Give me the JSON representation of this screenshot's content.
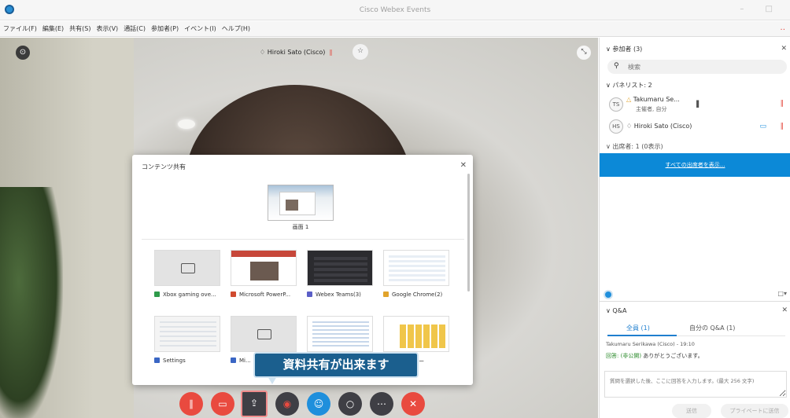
{
  "window": {
    "title": "Cisco Webex Events",
    "controls": "– □"
  },
  "menu": {
    "items": [
      "ファイル(F)",
      "編集(E)",
      "共有(S)",
      "表示(V)",
      "通話(C)",
      "参加者(P)",
      "イベント(I)",
      "ヘルプ(H)"
    ]
  },
  "video": {
    "speaker": "Hiroki Sato (Cisco)"
  },
  "share_dialog": {
    "title": "コンテンツ共有",
    "screen_label": "画面 1",
    "apps": [
      {
        "label": "Xbox gaming ove...",
        "thumb": "blank",
        "color": "#2e9b4a"
      },
      {
        "label": "Microsoft PowerP...",
        "thumb": "ppt",
        "color": "#d04a2f"
      },
      {
        "label": "Webex Teams(3)",
        "thumb": "teams",
        "color": "#5b5fc7"
      },
      {
        "label": "Google Chrome(2)",
        "thumb": "chrome",
        "color": "#e1a32b"
      },
      {
        "label": "Settings",
        "thumb": "settings",
        "color": "#3a66c4"
      },
      {
        "label": "Mi...",
        "thumb": "blank",
        "color": "#3a66c4"
      },
      {
        "label": "",
        "thumb": "doc",
        "color": "#3a66c4"
      },
      {
        "label": "...ネージャー",
        "thumb": "excel",
        "color": "#2e9b4a"
      }
    ]
  },
  "callout": {
    "text": "資料共有が出来ます"
  },
  "participants": {
    "header": "参加者 (3)",
    "search_placeholder": "検索",
    "panelists_header": "パネリスト: 2",
    "panelists": [
      {
        "initials": "TS",
        "name": "Takumaru Se...",
        "role": "主催者, 自分"
      },
      {
        "initials": "HS",
        "name": "Hiroki Sato (Cisco)",
        "role": ""
      }
    ],
    "attendees_header": "出席者: 1 (0表示)",
    "show_all_attendees": "すべての出席者を表示..."
  },
  "qa": {
    "header": "Q&A",
    "tabs": [
      "全員 (1)",
      "自分の Q&A (1)"
    ],
    "asker": "Takumaru Serikawa (Cisco) - 19:10",
    "answer_prefix": "回答:",
    "answer_tag": "(非公開)",
    "answer_text": "ありがとうございます。",
    "input_placeholder": "質問を選択した後、ここに回答を入力します。(最大 256 文字)",
    "send_label": "送信",
    "send_all_label": "プライベートに送信"
  },
  "colors": {
    "accent_blue": "#0c89d7",
    "mute_red": "#e94a3f",
    "callout_blue": "#1b5f8e"
  }
}
